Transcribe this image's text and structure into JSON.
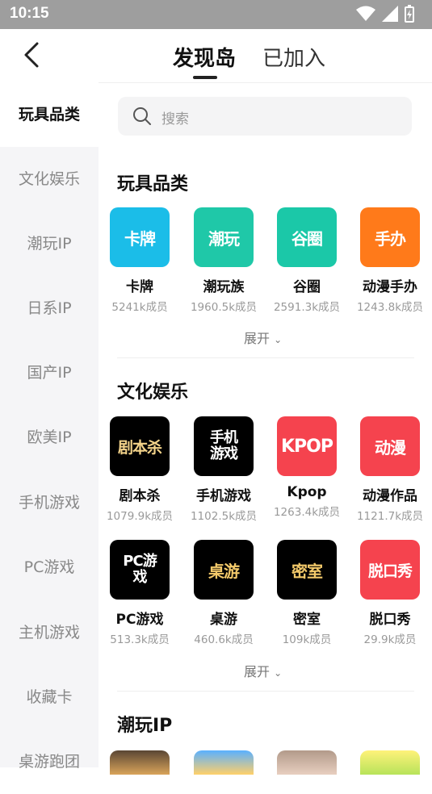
{
  "status_bar": {
    "time": "10:15"
  },
  "header": {
    "tabs": [
      "发现岛",
      "已加入"
    ],
    "active_tab": 0
  },
  "sidebar": {
    "items": [
      "玩具品类",
      "文化娱乐",
      "潮玩IP",
      "日系IP",
      "国产IP",
      "欧美IP",
      "手机游戏",
      "PC游戏",
      "主机游戏",
      "收藏卡",
      "桌游跑团"
    ],
    "active_index": 0
  },
  "search": {
    "placeholder": "搜索"
  },
  "sections": [
    {
      "title": "玩具品类",
      "items": [
        {
          "tile": "卡牌",
          "name": "卡牌",
          "count": "5241k成员",
          "color": "#1bbde8"
        },
        {
          "tile": "潮玩",
          "name": "潮玩族",
          "count": "1960.5k成员",
          "color": "#1fc8a8"
        },
        {
          "tile": "谷圈",
          "name": "谷圈",
          "count": "2591.3k成员",
          "color": "#1bc8a8"
        },
        {
          "tile": "手办",
          "name": "动漫手办",
          "count": "1243.8k成员",
          "color": "#ff7a1a"
        }
      ],
      "expand": "展开"
    },
    {
      "title": "文化娱乐",
      "items": [
        {
          "tile": "剧本杀",
          "name": "剧本杀",
          "count": "1079.9k成员",
          "color": "#000000",
          "text_color": "#f3d38a"
        },
        {
          "tile": "手机游戏",
          "name": "手机游戏",
          "count": "1102.5k成员",
          "color": "#000000",
          "text_color": "#ffffff"
        },
        {
          "tile": "KPOP",
          "name": "Kpop",
          "count": "1263.4k成员",
          "color": "#f5434e",
          "text_color": "#ffffff"
        },
        {
          "tile": "动漫",
          "name": "动漫作品",
          "count": "1121.7k成员",
          "color": "#f5434e",
          "text_color": "#ffffff"
        },
        {
          "tile": "PC游戏",
          "name": "PC游戏",
          "count": "513.3k成员",
          "color": "#000000",
          "text_color": "#ffffff"
        },
        {
          "tile": "桌游",
          "name": "桌游",
          "count": "460.6k成员",
          "color": "#000000",
          "text_color": "#f3c96a"
        },
        {
          "tile": "密室",
          "name": "密室",
          "count": "109k成员",
          "color": "#000000",
          "text_color": "#f3c96a"
        },
        {
          "tile": "脱口秀",
          "name": "脱口秀",
          "count": "29.9k成员",
          "color": "#f5434e",
          "text_color": "#ffffff"
        }
      ],
      "expand": "展开"
    },
    {
      "title": "潮玩IP"
    }
  ]
}
